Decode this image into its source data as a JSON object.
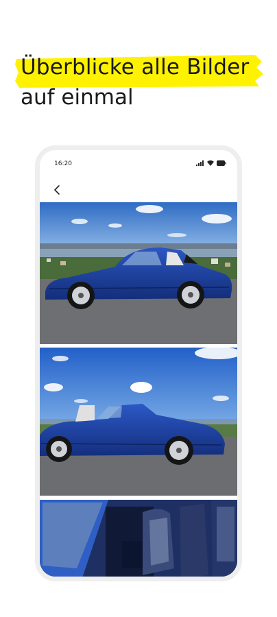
{
  "headline": {
    "line1": "Überblicke alle Bilder",
    "line2": "auf einmal",
    "highlight_color": "#fff200"
  },
  "phone": {
    "status_time": "16:20",
    "back_icon": "chevron-left-icon",
    "photos": [
      {
        "subject": "blue convertible side view, sky and lake in background"
      },
      {
        "subject": "blue convertible rear side view"
      },
      {
        "subject": "car interior with blue seats"
      }
    ]
  },
  "colors": {
    "car_blue": "#1b3f9c",
    "sky_blue": "#3f7fd0",
    "asphalt": "#6d6e70"
  }
}
